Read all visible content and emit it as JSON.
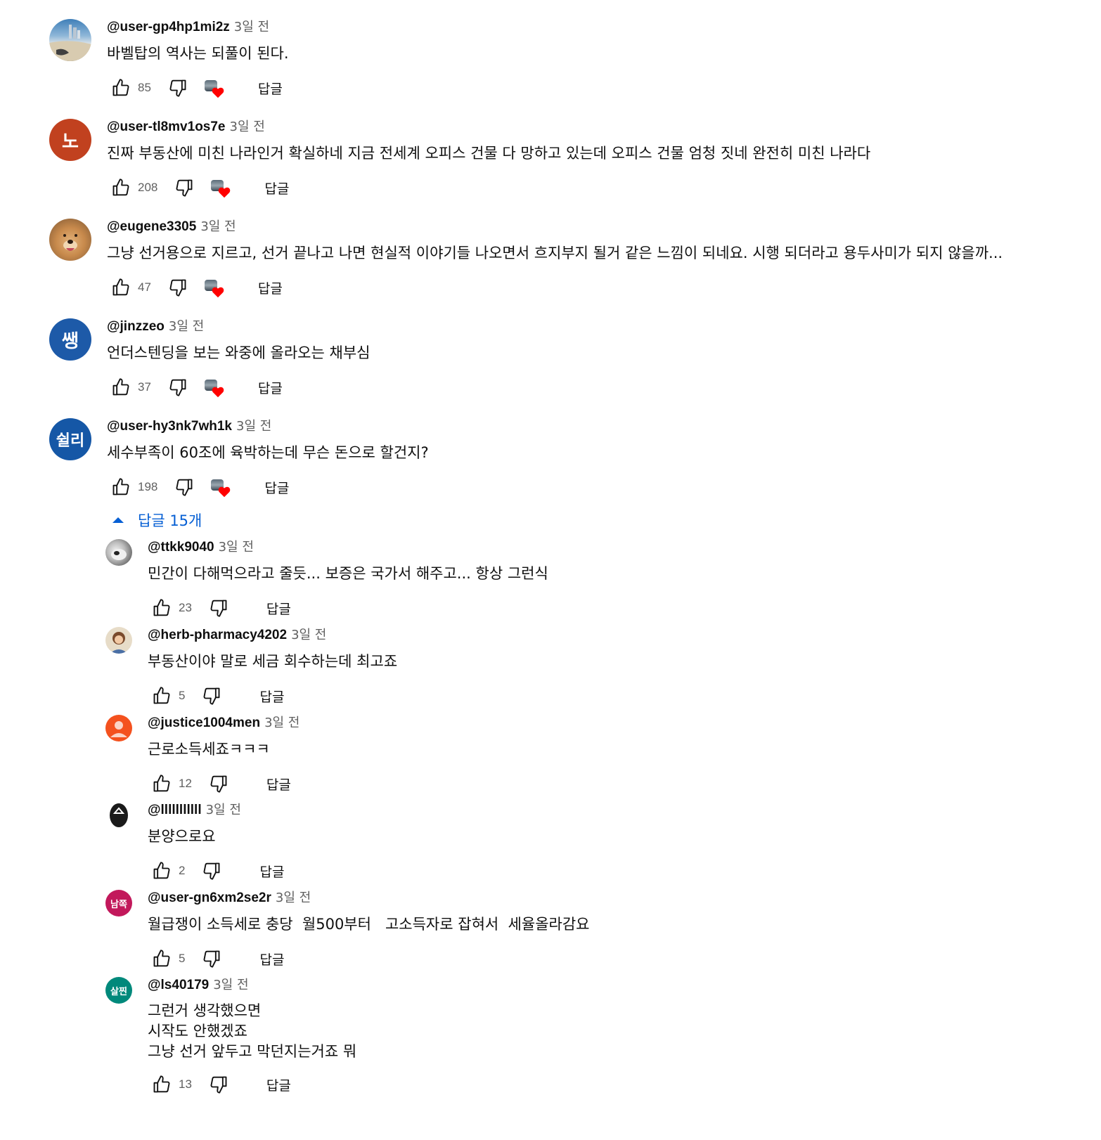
{
  "reply_label": "답글",
  "replies_toggle": "답글 15개",
  "colors": {
    "link": "#065fd4",
    "heart": "#ff0000"
  },
  "comments": [
    {
      "author": "@user-gp4hp1mi2z",
      "time": "3일 전",
      "text": "바벨탑의 역사는 되풀이 된다.",
      "likes": "85",
      "avatar": "beach-photo"
    },
    {
      "author": "@user-tl8mv1os7e",
      "time": "3일 전",
      "text": "진짜 부동산에 미친 나라인거 확실하네 지금 전세계 오피스 건물 다 망하고 있는데 오피스 건물 엄청 짓네 완전히 미친 나라다",
      "likes": "208",
      "avatar_letter": "노",
      "avatar_color": "#c1411f"
    },
    {
      "author": "@eugene3305",
      "time": "3일 전",
      "text": "그냥 선거용으로 지르고, 선거 끝나고 나면 현실적 이야기들 나오면서 흐지부지 될거 같은 느낌이 되네요. 시행 되더라고 용두사미가 되지 않을까...",
      "likes": "47",
      "avatar": "dog-photo"
    },
    {
      "author": "@jinzzeo",
      "time": "3일 전",
      "text": "언더스텐딩을 보는 와중에 올라오는 채부심",
      "likes": "37",
      "avatar_letter": "쌩",
      "avatar_color": "#1d5aa8"
    },
    {
      "author": "@user-hy3nk7wh1k",
      "time": "3일 전",
      "text": "세수부족이 60조에 육박하는데 무슨 돈으로 할건지?",
      "likes": "198",
      "avatar_letter": "쉴리",
      "avatar_color": "#1557a6"
    }
  ],
  "replies": [
    {
      "author": "@ttkk9040",
      "time": "3일 전",
      "text": "민간이 다해먹으라고 줄듯... 보증은 국가서 해주고... 항상 그런식",
      "likes": "23",
      "avatar": "cat-photo"
    },
    {
      "author": "@herb-pharmacy4202",
      "time": "3일 전",
      "text": "부동산이야 말로 세금 회수하는데 최고죠",
      "likes": "5",
      "avatar": "person-photo"
    },
    {
      "author": "@justice1004men",
      "time": "3일 전",
      "text": "근로소득세죠ㅋㅋㅋ",
      "likes": "12",
      "avatar": "default-user"
    },
    {
      "author": "@lllllllllll",
      "time": "3일 전",
      "text": "분양으로요",
      "likes": "2",
      "avatar": "mask-photo"
    },
    {
      "author": "@user-gn6xm2se2r",
      "time": "3일 전",
      "text": "월급쟁이 소득세로 충당  월500부터   고소득자로 잡혀서  세율올라감요",
      "likes": "5",
      "avatar_letter": "남쪽",
      "avatar_color": "#c2185b"
    },
    {
      "author": "@ls40179",
      "time": "3일 전",
      "text": "그런거 생각했으면\n시작도 안했겠죠\n그냥 선거 앞두고 막던지는거죠 뭐",
      "likes": "13",
      "avatar_letter": "살찐",
      "avatar_color": "#00897b"
    }
  ]
}
